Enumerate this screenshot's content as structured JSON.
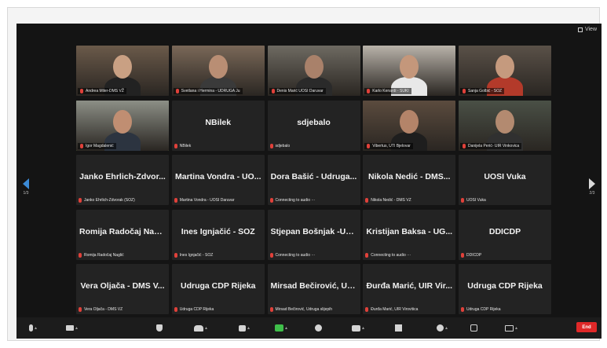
{
  "window": {
    "view_label": "View"
  },
  "nav": {
    "prev_page": "1/3",
    "next_page": "2/3"
  },
  "tiles": [
    {
      "caption": "Andrea Miler-DMS VŽ",
      "type": "video",
      "tone": "#6b5a4a",
      "skin": "#c9a083",
      "shirt": "#222"
    },
    {
      "caption": "Svetlana i Hermina - UDRUGA Ju",
      "type": "video",
      "tone": "#7a6858",
      "skin": "#b98e74",
      "shirt": "#3a3a3a"
    },
    {
      "caption": "Denis Marić UOSI Daruvar",
      "type": "video",
      "tone": "#6e6a62",
      "skin": "#a9816a",
      "shirt": "#2a2a2a"
    },
    {
      "caption": "Karlo Kenardi - SUKI",
      "type": "video",
      "tone": "#b9b3aa",
      "skin": "#c4977b",
      "shirt": "#e8e8e8"
    },
    {
      "caption": "Sanja Golbić - SOZ",
      "type": "video",
      "tone": "#5a5148",
      "skin": "#c59a7e",
      "shirt": "#b33a2a"
    },
    {
      "caption": "Igor Magdalenić",
      "type": "video",
      "speaking": true,
      "tone": "#8c8f86",
      "skin": "#c08e72",
      "shirt": "#2c3440"
    },
    {
      "name": "NBilek",
      "caption": "NBilek",
      "type": "name"
    },
    {
      "name": "sdjebalo",
      "caption": "sdjebalo",
      "type": "name"
    },
    {
      "caption": "Vibertus, UTI Bjelovar",
      "type": "video",
      "tone": "#5b4b3e",
      "skin": "#b48469",
      "shirt": "#1e1e1e"
    },
    {
      "caption": "Danijela Perić- UIR Vinkovica",
      "type": "video",
      "tone": "#4a5046",
      "skin": "#b38a70",
      "shirt": "#303030"
    },
    {
      "name": "Janko Ehrlich-Zdvor...",
      "caption": "Janko Ehrlich-Zdvorak (SOZ)",
      "type": "name"
    },
    {
      "name": "Martina Vondra - UO...",
      "caption": "Martina Vondra - UOSI Daruvar",
      "type": "name"
    },
    {
      "name": "Dora Bašić - Udruga...",
      "caption": "Connecting to audio ···",
      "type": "name"
    },
    {
      "name": "Nikola Nedić - DMS...",
      "caption": "Nikola Nedić - DMS VŽ",
      "type": "name"
    },
    {
      "name": "UOSI Vuka",
      "caption": "UOSI Vuka",
      "type": "name"
    },
    {
      "name": "Romija Radočaj Naglić",
      "caption": "Romija Radočaj Naglić",
      "type": "name"
    },
    {
      "name": "Ines Ignjačić - SOZ",
      "caption": "Ines Ignjačić - SOZ",
      "type": "name"
    },
    {
      "name": "Stjepan Bošnjak -UG...",
      "caption": "Connecting to audio ···",
      "type": "name"
    },
    {
      "name": "Kristijan Baksa - UG...",
      "caption": "Connecting to audio ···",
      "type": "name"
    },
    {
      "name": "DDICDP",
      "caption": "DDICDP",
      "type": "name"
    },
    {
      "name": "Vera Oljača - DMS V...",
      "caption": "Vera Oljača - DMS VŽ",
      "type": "name"
    },
    {
      "name": "Udruga CDP Rijeka",
      "caption": "Udruga CDP Rijeka",
      "type": "name"
    },
    {
      "name": "Mirsad Bečirović, Ud...",
      "caption": "Mirsad Bečirović, Udruga slijepih",
      "type": "name"
    },
    {
      "name": "Đurđa Marić, UIR Vir...",
      "caption": "Đurđa Marić, UIR Virovitica",
      "type": "name"
    },
    {
      "name": "Udruga CDP Rijeka",
      "caption": "Udruga CDP Rijeka",
      "type": "name"
    }
  ],
  "toolbar": {
    "end_label": "End"
  },
  "colors": {
    "speaking": "#7ed957",
    "mic_muted": "#e0413a",
    "end": "#e02828"
  }
}
